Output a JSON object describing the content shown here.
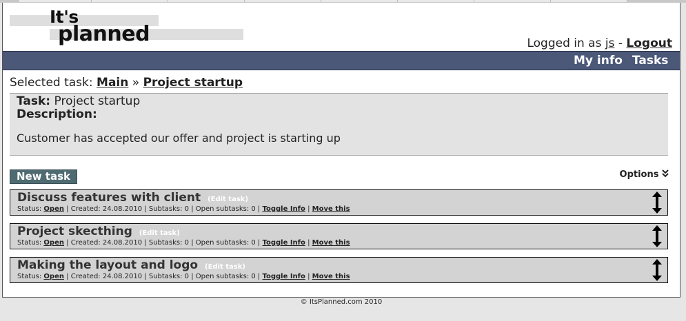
{
  "logo": {
    "line1": "It's",
    "line2": "planned"
  },
  "login": {
    "prefix": "Logged in as",
    "user": "js",
    "separator": "-",
    "logout": "Logout"
  },
  "nav": [
    {
      "label": "My info"
    },
    {
      "label": "Tasks"
    }
  ],
  "breadcrumb": {
    "prefix": "Selected task:",
    "root": "Main",
    "sep": "»",
    "current": "Project startup"
  },
  "task": {
    "label": "Task:",
    "name": "Project startup",
    "description_label": "Description:",
    "description": "Customer has accepted our offer and project is starting up"
  },
  "actions": {
    "new_task": "New task",
    "options": "Options"
  },
  "subtasks": [
    {
      "title": "Discuss features with client",
      "edit": "(Edit task)",
      "status_label": "Status:",
      "status": "Open",
      "created": "Created: 24.08.2010",
      "subtasks": "Subtasks: 0",
      "open_subtasks": "Open subtasks: 0",
      "toggle": "Toggle Info",
      "move": "Move this"
    },
    {
      "title": "Project skecthing",
      "edit": "(Edit task)",
      "status_label": "Status:",
      "status": "Open",
      "created": "Created: 24.08.2010",
      "subtasks": "Subtasks: 0",
      "open_subtasks": "Open subtasks: 0",
      "toggle": "Toggle Info",
      "move": "Move this"
    },
    {
      "title": "Making the layout and logo",
      "edit": "(Edit task)",
      "status_label": "Status:",
      "status": "Open",
      "created": "Created: 24.08.2010",
      "subtasks": "Subtasks: 0",
      "open_subtasks": "Open subtasks: 0",
      "toggle": "Toggle Info",
      "move": "Move this"
    }
  ],
  "footer": "© ItsPlanned.com 2010"
}
